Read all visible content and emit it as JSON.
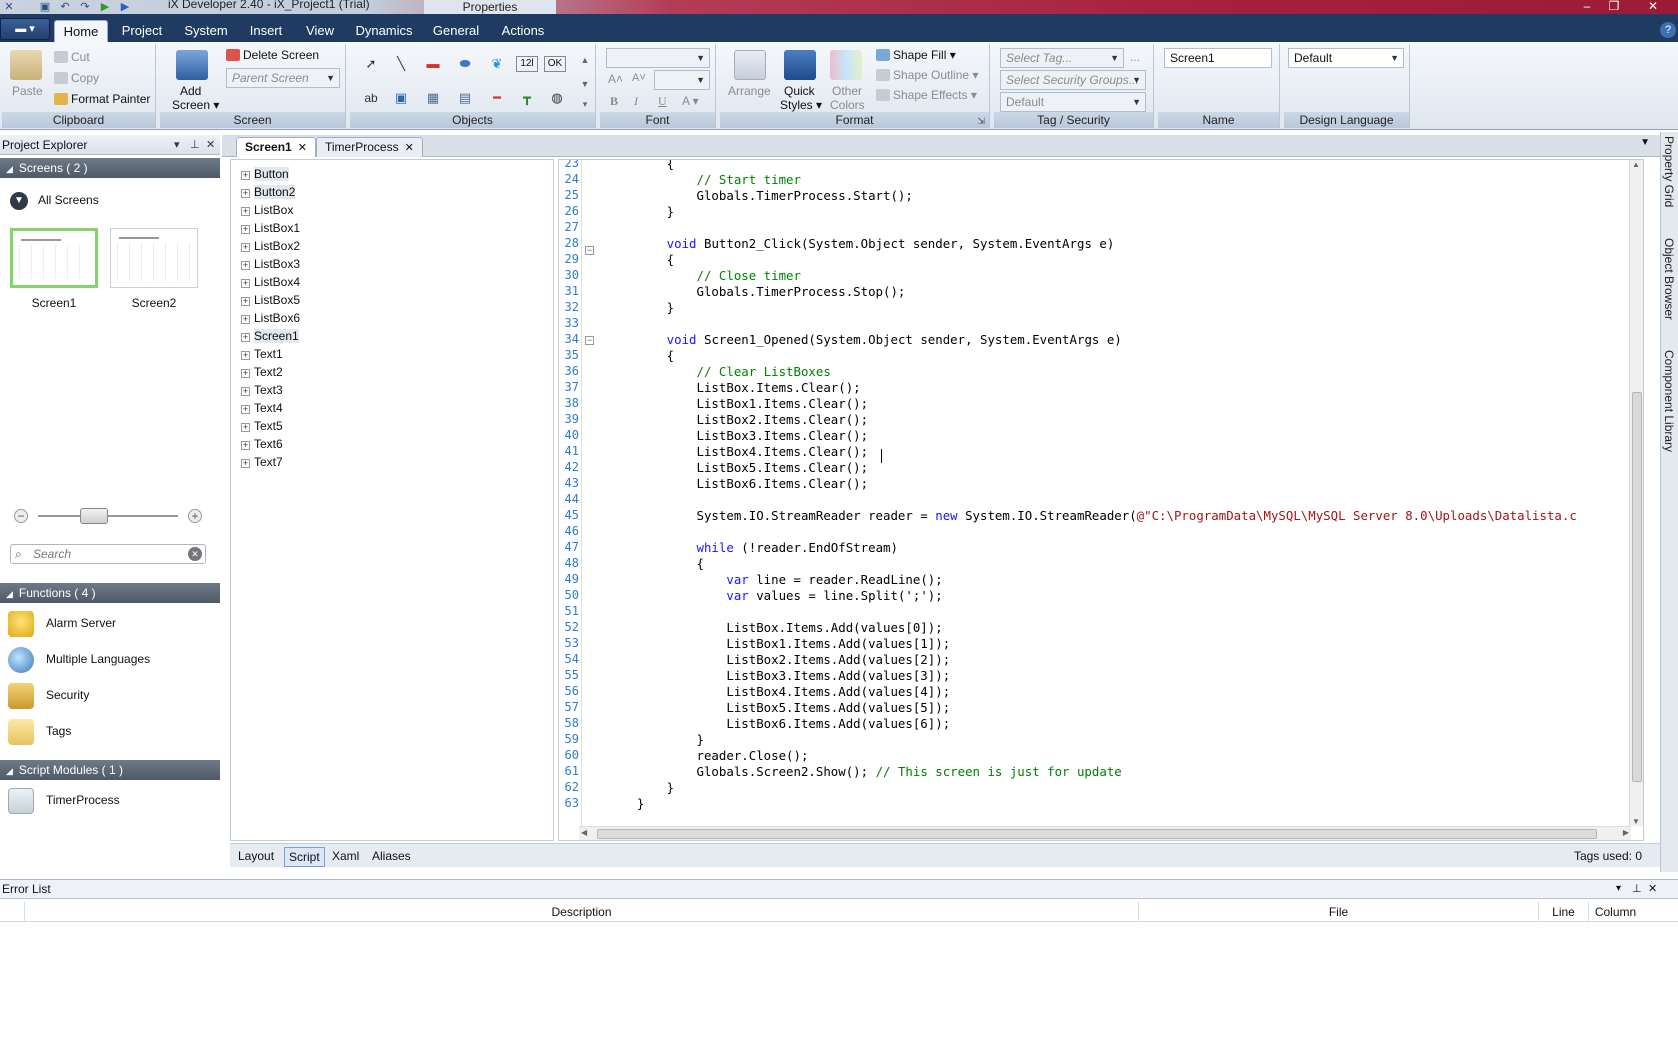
{
  "titlebar": {
    "app_title": "iX Developer 2.40 - iX_Project1 (Trial)",
    "context_tab": "Properties"
  },
  "ribbon_tabs": [
    "Home",
    "Project",
    "System",
    "Insert",
    "View",
    "Dynamics",
    "General",
    "Actions"
  ],
  "ribbon": {
    "clipboard": {
      "paste": "Paste",
      "cut": "Cut",
      "copy": "Copy",
      "format_painter": "Format Painter",
      "label": "Clipboard"
    },
    "screen": {
      "add_screen": "Add",
      "add_screen2": "Screen",
      "delete_screen": "Delete Screen",
      "parent_screen": "Parent Screen",
      "label": "Screen"
    },
    "objects": {
      "label": "Objects",
      "numeric_icon": "12l",
      "ok_icon": "OK",
      "text_icon": "ab"
    },
    "font": {
      "label": "Font",
      "bold": "B",
      "italic": "I",
      "underline": "U"
    },
    "format": {
      "arrange": "Arrange",
      "quick_styles": "Quick",
      "quick_styles2": "Styles",
      "other_colors": "Other",
      "other_colors2": "Colors",
      "shape_fill": "Shape Fill",
      "shape_outline": "Shape Outline",
      "shape_effects": "Shape Effects",
      "label": "Format"
    },
    "tag_security": {
      "select_tag": "Select Tag...",
      "select_security": "Select Security Groups...",
      "default_value": "Default",
      "label": "Tag / Security"
    },
    "name": {
      "value": "Screen1",
      "label": "Name"
    },
    "design_language": {
      "value": "Default",
      "label": "Design Language"
    }
  },
  "project_explorer": {
    "title": "Project Explorer",
    "screens_header": "Screens ( 2 )",
    "all_screens": "All Screens",
    "screens": [
      "Screen1",
      "Screen2"
    ],
    "search_placeholder": "Search",
    "functions_header": "Functions ( 4 )",
    "functions": [
      "Alarm Server",
      "Multiple Languages",
      "Security",
      "Tags"
    ],
    "script_modules_header": "Script Modules ( 1 )",
    "script_modules": [
      "TimerProcess"
    ]
  },
  "doc_tabs": [
    "Screen1",
    "TimerProcess"
  ],
  "object_tree": [
    "Button",
    "Button2",
    "ListBox",
    "ListBox1",
    "ListBox2",
    "ListBox3",
    "ListBox4",
    "ListBox5",
    "ListBox6",
    "Screen1",
    "Text1",
    "Text2",
    "Text3",
    "Text4",
    "Text5",
    "Text6",
    "Text7"
  ],
  "code_lines": [
    {
      "n": "23",
      "t": "        {"
    },
    {
      "n": "24",
      "c": "            // Start timer"
    },
    {
      "n": "25",
      "t": "            Globals.TimerProcess.Start();"
    },
    {
      "n": "26",
      "t": "        }"
    },
    {
      "n": "27",
      "t": ""
    },
    {
      "n": "28",
      "k": "        void",
      "t": " Button2_Click(System.Object sender, System.EventArgs e)"
    },
    {
      "n": "29",
      "t": "        {"
    },
    {
      "n": "30",
      "c": "            // Close timer"
    },
    {
      "n": "31",
      "t": "            Globals.TimerProcess.Stop();"
    },
    {
      "n": "32",
      "t": "        }"
    },
    {
      "n": "33",
      "t": ""
    },
    {
      "n": "34",
      "k": "        void",
      "t": " Screen1_Opened(System.Object sender, System.EventArgs e)"
    },
    {
      "n": "35",
      "t": "        {"
    },
    {
      "n": "36",
      "c": "            // Clear ListBoxes"
    },
    {
      "n": "37",
      "t": "            ListBox.Items.Clear();"
    },
    {
      "n": "38",
      "t": "            ListBox1.Items.Clear();"
    },
    {
      "n": "39",
      "t": "            ListBox2.Items.Clear();"
    },
    {
      "n": "40",
      "t": "            ListBox3.Items.Clear();"
    },
    {
      "n": "41",
      "t": "            ListBox4.Items.Clear();"
    },
    {
      "n": "42",
      "t": "            ListBox5.Items.Clear();"
    },
    {
      "n": "43",
      "t": "            ListBox6.Items.Clear();"
    },
    {
      "n": "44",
      "t": ""
    },
    {
      "n": "45",
      "t": "            System.IO.StreamReader reader = ",
      "k2": "new",
      "t2": " System.IO.StreamReader(",
      "s": "@\"C:\\ProgramData\\MySQL\\MySQL Server 8.0\\Uploads\\Datalista.c"
    },
    {
      "n": "46",
      "t": ""
    },
    {
      "n": "47",
      "k": "            while",
      "t": " (!reader.EndOfStream)"
    },
    {
      "n": "48",
      "t": "            {"
    },
    {
      "n": "49",
      "k": "                var",
      "t": " line = reader.ReadLine();"
    },
    {
      "n": "50",
      "k": "                var",
      "t": " values = line.Split(';');"
    },
    {
      "n": "51",
      "t": ""
    },
    {
      "n": "52",
      "t": "                ListBox.Items.Add(values[0]);"
    },
    {
      "n": "53",
      "t": "                ListBox1.Items.Add(values[1]);"
    },
    {
      "n": "54",
      "t": "                ListBox2.Items.Add(values[2]);"
    },
    {
      "n": "55",
      "t": "                ListBox3.Items.Add(values[3]);"
    },
    {
      "n": "56",
      "t": "                ListBox4.Items.Add(values[4]);"
    },
    {
      "n": "57",
      "t": "                ListBox5.Items.Add(values[5]);"
    },
    {
      "n": "58",
      "t": "                ListBox6.Items.Add(values[6]);"
    },
    {
      "n": "59",
      "t": "            }"
    },
    {
      "n": "60",
      "t": "            reader.Close();"
    },
    {
      "n": "61",
      "t": "            Globals.Screen2.Show(); ",
      "c2": "// This screen is just for update"
    },
    {
      "n": "62",
      "t": "        }"
    },
    {
      "n": "63",
      "t": "    }"
    }
  ],
  "view_tabs": [
    "Layout",
    "Script",
    "Xaml",
    "Aliases"
  ],
  "tags_used": "Tags used: 0",
  "right_dock": [
    "Property Grid",
    "Object Browser",
    "Component Library"
  ],
  "error_list": {
    "title": "Error List",
    "columns": [
      "Description",
      "File",
      "Line",
      "Column"
    ]
  }
}
